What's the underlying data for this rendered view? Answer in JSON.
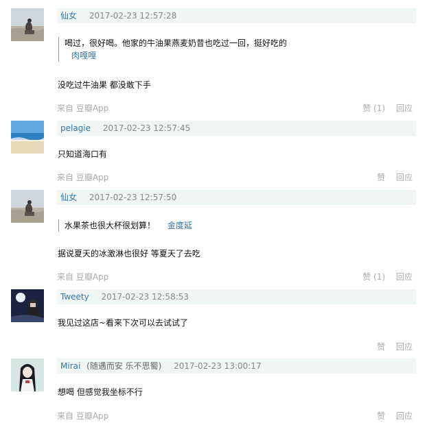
{
  "comments": [
    {
      "author": "仙女",
      "time": "2017-02-23 12:57:28",
      "quote_text": "喝过，很好喝。他家的牛油果燕麦奶昔也吃过一回，挺好吃的",
      "quote_author": "肉嘎嘎",
      "text": "没吃过牛油果 都没敢下手",
      "source": "来自 豆瓣App",
      "like_label": "赞 (1)",
      "reply_label": "回应"
    },
    {
      "author": "pelagie",
      "time": "2017-02-23 12:57:45",
      "text": "只知道海口有",
      "source": "来自 豆瓣App",
      "like_label": "赞",
      "reply_label": "回应"
    },
    {
      "author": "仙女",
      "time": "2017-02-23 12:57:50",
      "quote_text": "水果茶也很大杯很划算！",
      "quote_author": "金度延",
      "text": "据说夏天的冰激淋也很好 等夏天了去吃",
      "source": "来自 豆瓣App",
      "like_label": "赞 (1)",
      "reply_label": "回应"
    },
    {
      "author": "Tweety",
      "time": "2017-02-23 12:58:53",
      "text": "我见过这店~看来下次可以去试试了",
      "like_label": "赞",
      "reply_label": "回应"
    },
    {
      "author": "Mirai",
      "author_note": "(随遇而安 乐不思蜀)",
      "time": "2017-02-23 13:00:17",
      "text": "想喝 但感觉我坐标不行",
      "source": "来自 豆瓣App",
      "like_label": "赞",
      "reply_label": "回应"
    }
  ]
}
